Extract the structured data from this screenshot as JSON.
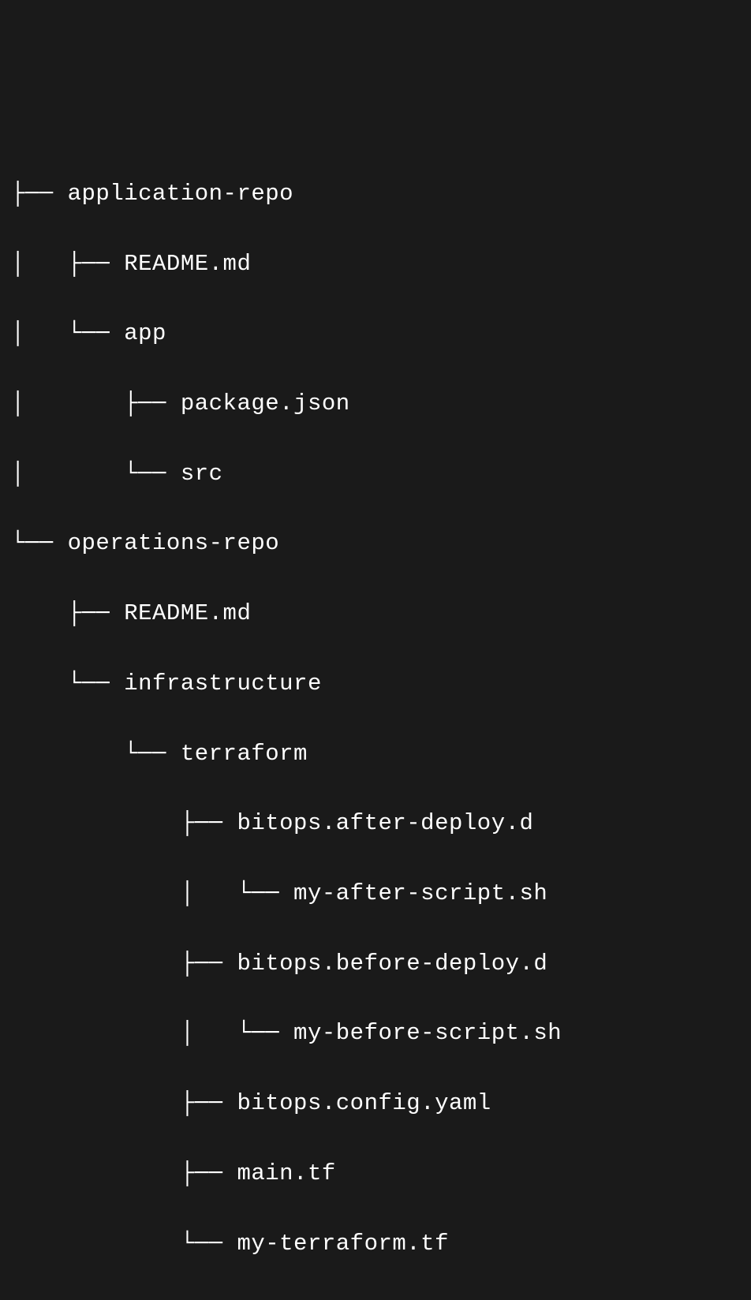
{
  "tree": {
    "lines": [
      "├── application-repo",
      "│   ├── README.md",
      "│   └── app",
      "│       ├── package.json",
      "│       └── src",
      "└── operations-repo",
      "    ├── README.md",
      "    └── infrastructure",
      "        └── terraform",
      "            ├── bitops.after-deploy.d",
      "            │   └── my-after-script.sh",
      "            ├── bitops.before-deploy.d",
      "            │   └── my-before-script.sh",
      "            ├── bitops.config.yaml",
      "            ├── main.tf",
      "            └── my-terraform.tf"
    ]
  }
}
